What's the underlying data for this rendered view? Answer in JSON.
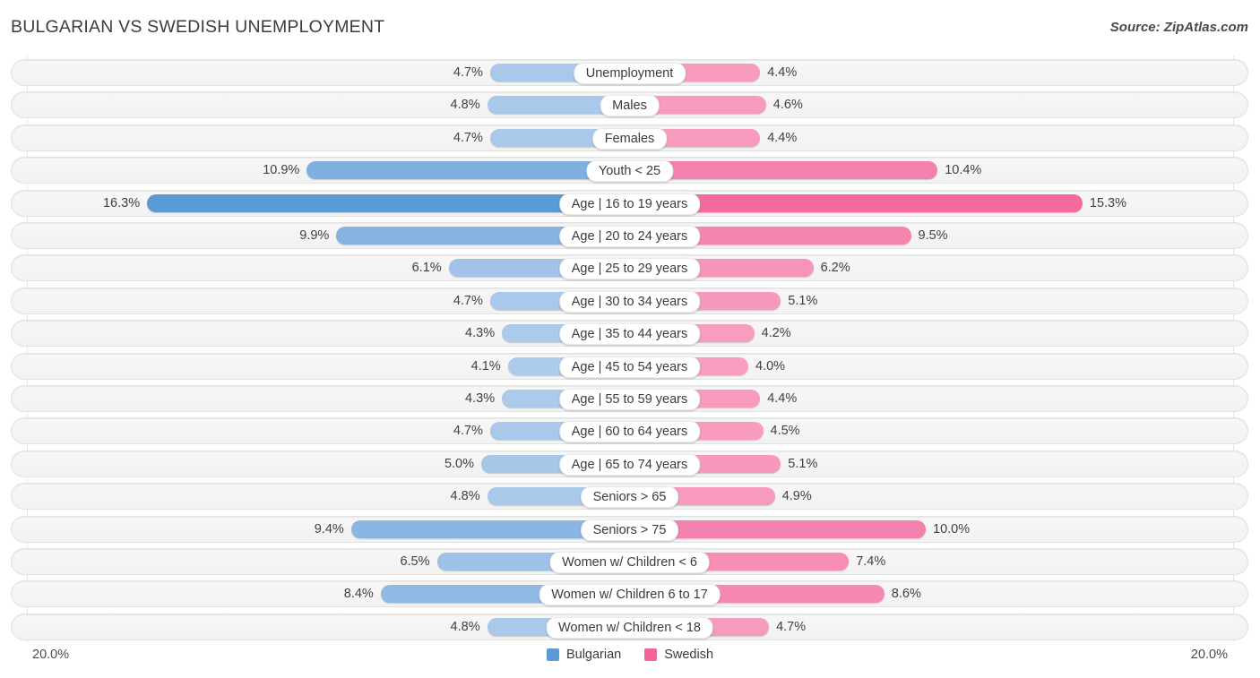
{
  "header": {
    "title": "BULGARIAN VS SWEDISH UNEMPLOYMENT",
    "source": "Source: ZipAtlas.com"
  },
  "legend": {
    "items": [
      {
        "label": "Bulgarian",
        "color": "#5b9bd5"
      },
      {
        "label": "Swedish",
        "color": "#f2659b"
      }
    ]
  },
  "axis": {
    "left_label": "20.0%",
    "right_label": "20.0%",
    "max": 20.0
  },
  "colors": {
    "blue_light": "#aecbeb",
    "blue_dark": "#5b9bd5",
    "pink_light": "#f79ec0",
    "pink_dark": "#f2659b",
    "track": "#f5f5f5",
    "text": "#404040"
  },
  "chart_data": {
    "type": "bar",
    "title": "BULGARIAN VS SWEDISH UNEMPLOYMENT",
    "xlabel": "",
    "ylabel": "",
    "orientation": "horizontal-diverging",
    "xlim": [
      20.0,
      20.0
    ],
    "grid": true,
    "legend_position": "bottom-center",
    "categories": [
      "Unemployment",
      "Males",
      "Females",
      "Youth < 25",
      "Age | 16 to 19 years",
      "Age | 20 to 24 years",
      "Age | 25 to 29 years",
      "Age | 30 to 34 years",
      "Age | 35 to 44 years",
      "Age | 45 to 54 years",
      "Age | 55 to 59 years",
      "Age | 60 to 64 years",
      "Age | 65 to 74 years",
      "Seniors > 65",
      "Seniors > 75",
      "Women w/ Children < 6",
      "Women w/ Children 6 to 17",
      "Women w/ Children < 18"
    ],
    "series": [
      {
        "name": "Bulgarian",
        "side": "left",
        "values": [
          4.7,
          4.8,
          4.7,
          10.9,
          16.3,
          9.9,
          6.1,
          4.7,
          4.3,
          4.1,
          4.3,
          4.7,
          5.0,
          4.8,
          9.4,
          6.5,
          8.4,
          4.8
        ],
        "labels": [
          "4.7%",
          "4.8%",
          "4.7%",
          "10.9%",
          "16.3%",
          "9.9%",
          "6.1%",
          "4.7%",
          "4.3%",
          "4.1%",
          "4.3%",
          "4.7%",
          "5.0%",
          "4.8%",
          "9.4%",
          "6.5%",
          "8.4%",
          "4.8%"
        ]
      },
      {
        "name": "Swedish",
        "side": "right",
        "values": [
          4.4,
          4.6,
          4.4,
          10.4,
          15.3,
          9.5,
          6.2,
          5.1,
          4.2,
          4.0,
          4.4,
          4.5,
          5.1,
          4.9,
          10.0,
          7.4,
          8.6,
          4.7
        ],
        "labels": [
          "4.4%",
          "4.6%",
          "4.4%",
          "10.4%",
          "15.3%",
          "9.5%",
          "6.2%",
          "5.1%",
          "4.2%",
          "4.0%",
          "4.4%",
          "4.5%",
          "5.1%",
          "4.9%",
          "10.0%",
          "7.4%",
          "8.6%",
          "4.7%"
        ]
      }
    ]
  }
}
